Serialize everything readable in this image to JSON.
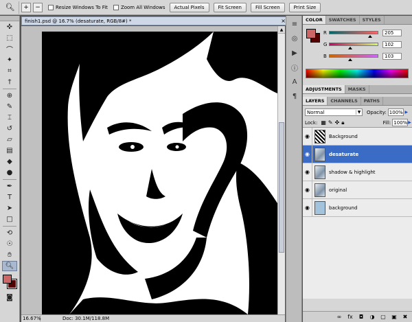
{
  "options_bar": {
    "tool_icon": "zoom-icon",
    "zoom_in_glyph": "+",
    "zoom_out_glyph": "−",
    "resize_windows_label": "Resize Windows To Fit",
    "zoom_all_label": "Zoom All Windows",
    "actual_pixels_label": "Actual Pixels",
    "fit_screen_label": "Fit Screen",
    "fill_screen_label": "Fill Screen",
    "print_size_label": "Print Size"
  },
  "document": {
    "tab_title": "finish1.psd @ 16.7% (desaturate, RGB/8#) *",
    "close_glyph": "×",
    "status_zoom": "16.67%",
    "status_info": "Doc: 30.1M/118.8M"
  },
  "color_panel": {
    "tabs": [
      "COLOR",
      "SWATCHES",
      "STYLES"
    ],
    "foreground_color": "#cd6667",
    "background_color": "#550000",
    "channels": [
      {
        "label": "R",
        "value": "205",
        "level": 0.8
      },
      {
        "label": "G",
        "value": "102",
        "level": 0.4
      },
      {
        "label": "B",
        "value": "103",
        "level": 0.4
      }
    ]
  },
  "adjustments_tabs": [
    "ADJUSTMENTS",
    "MASKS"
  ],
  "layers_panel": {
    "tabs": [
      "LAYERS",
      "CHANNELS",
      "PATHS"
    ],
    "blend_mode": "Normal",
    "opacity_label": "Opacity:",
    "opacity_value": "100%",
    "lock_label": "Lock:",
    "fill_label": "Fill:",
    "fill_value": "100%",
    "layers": [
      {
        "name": "Background",
        "selected": false
      },
      {
        "name": "desaturate",
        "selected": true
      },
      {
        "name": "shadow & highlight",
        "selected": false
      },
      {
        "name": "original",
        "selected": false
      },
      {
        "name": "background",
        "selected": false
      }
    ]
  },
  "colors": {
    "selected_layer": "#3a6cc6",
    "foreground": "#cd6667",
    "background": "#550000"
  }
}
